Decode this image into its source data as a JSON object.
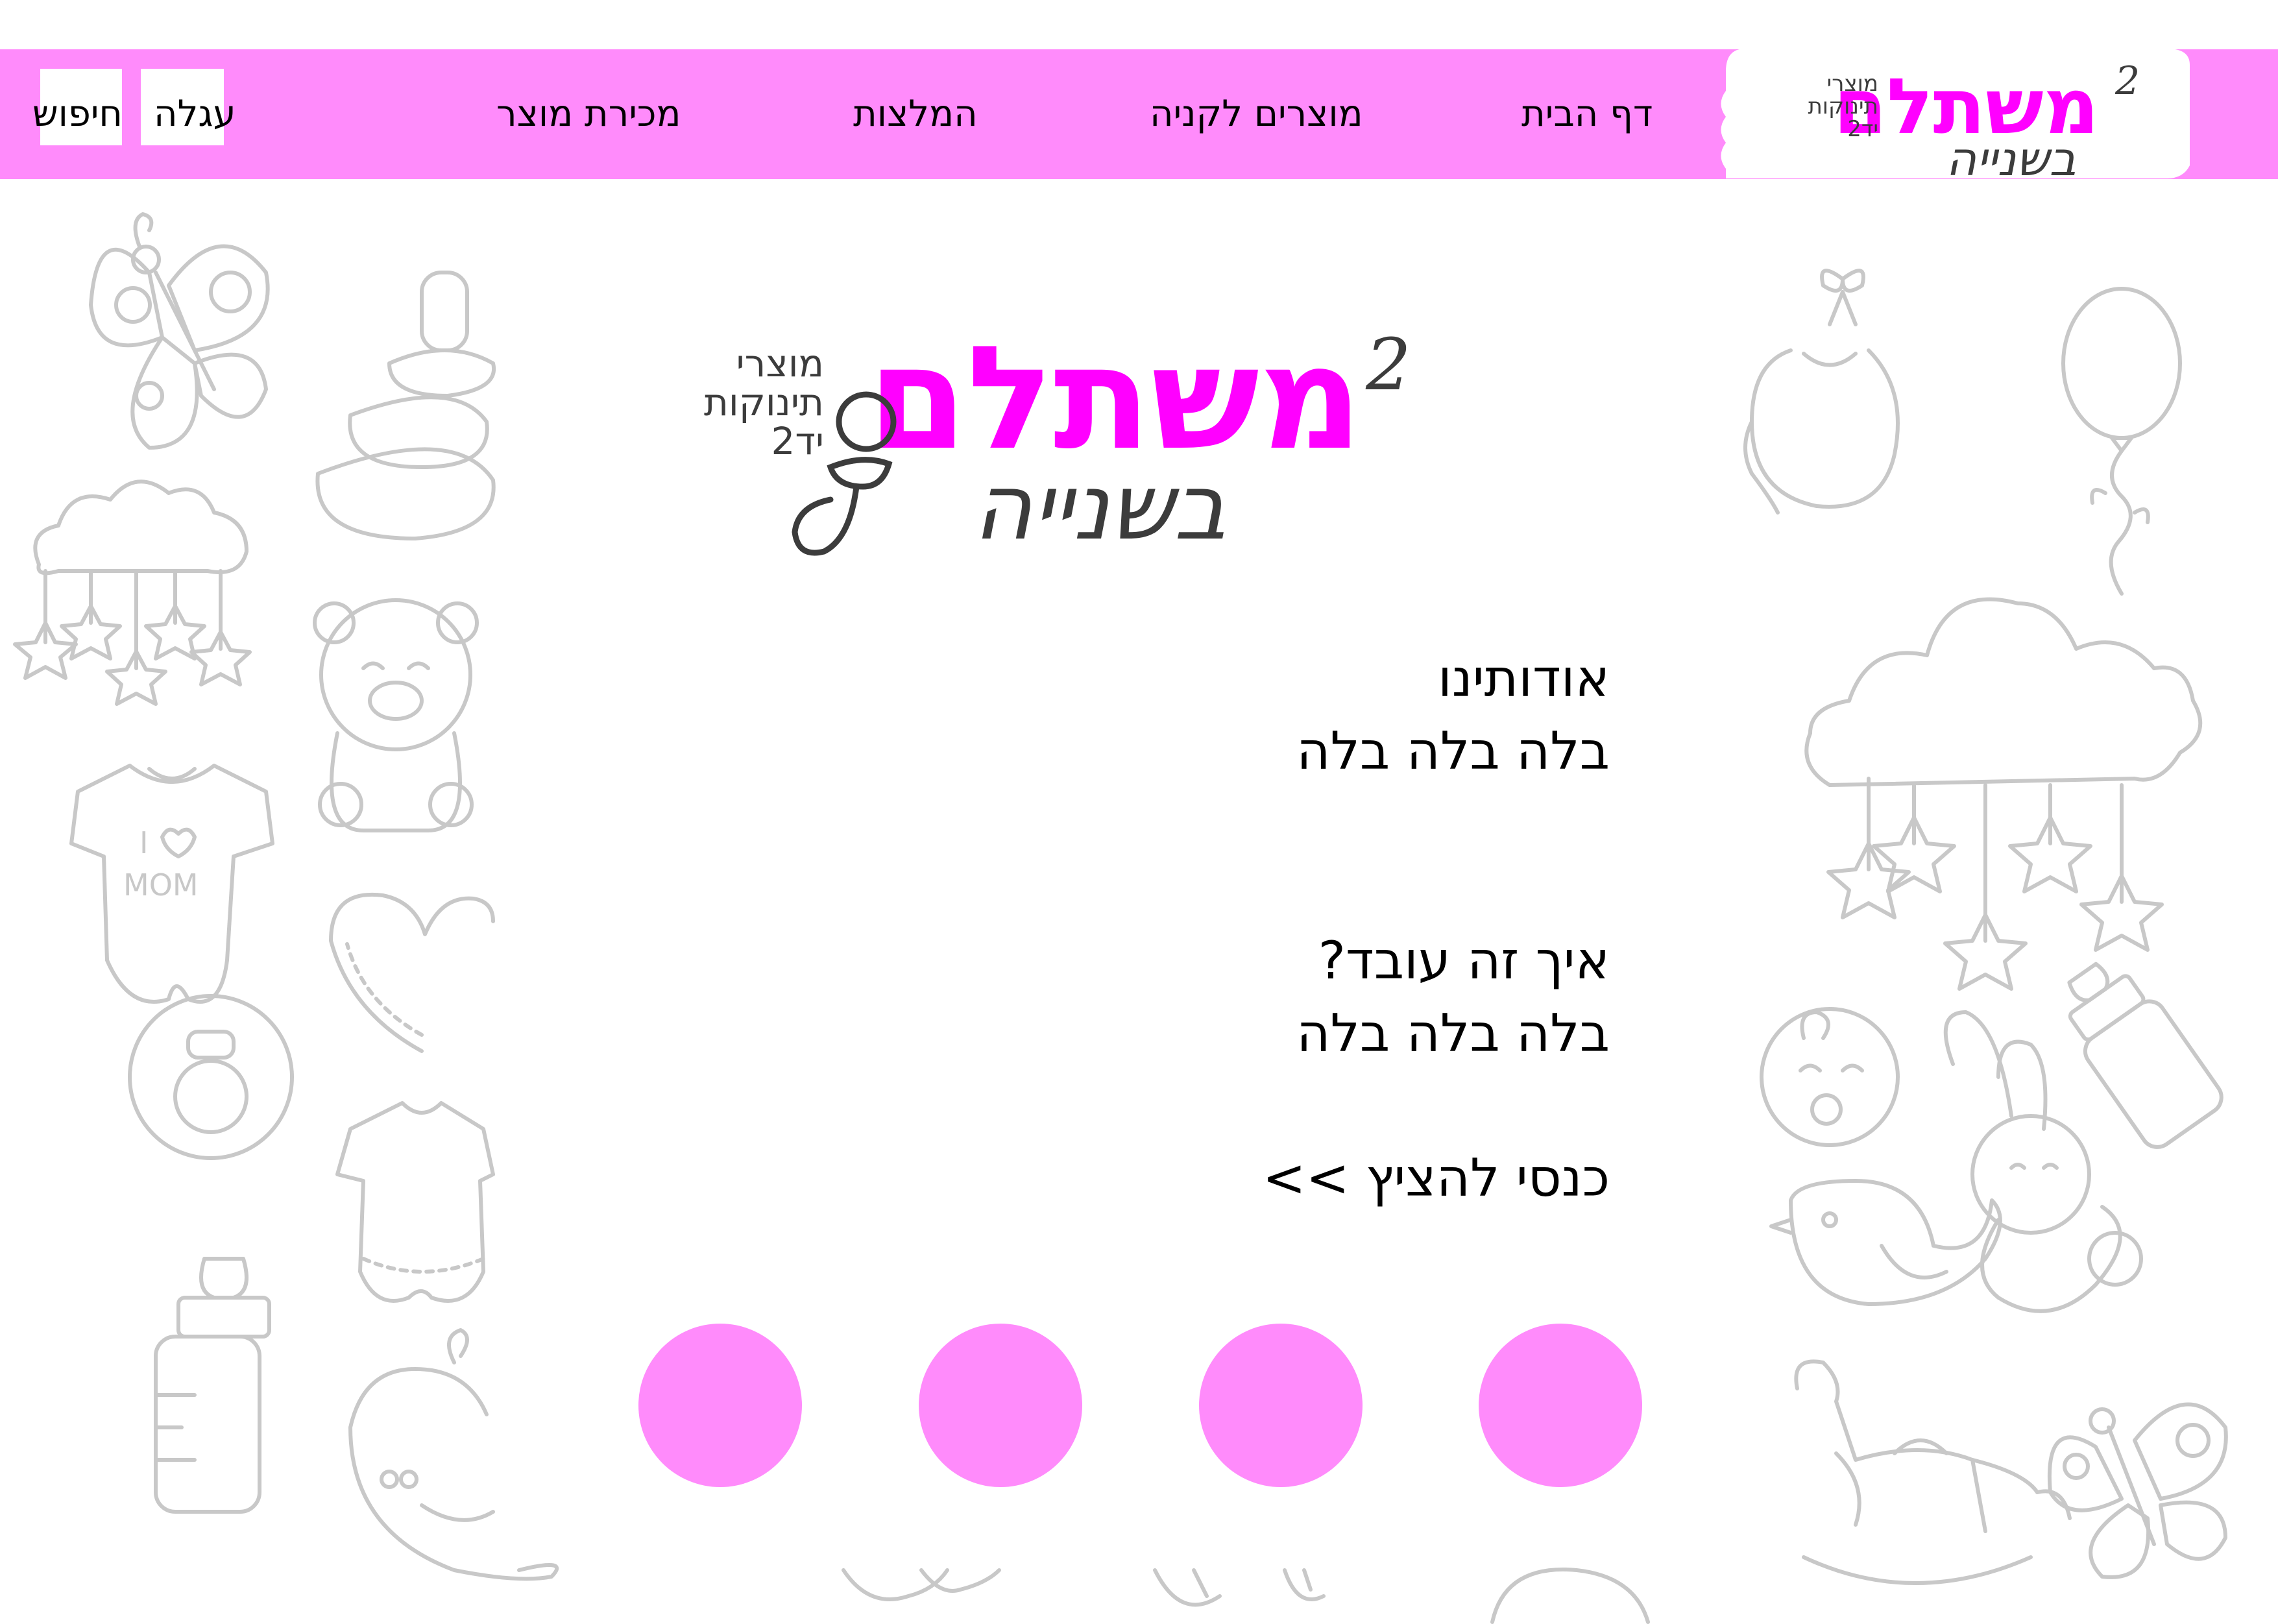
{
  "colors": {
    "brand_pink": "#ff8bfb",
    "logo_magenta": "#ff00ff",
    "doodle_gray": "#c8c8c8",
    "logo_gray": "#3c3c3c"
  },
  "logo": {
    "title": "משתלם",
    "superscript": "2",
    "subtitle": "בשנייה",
    "side_line_1": "מוצרי",
    "side_line_2": "תינוקות",
    "side_line_3": "יד2"
  },
  "nav": {
    "home": "דף הבית",
    "products": "מוצרים לקניה",
    "recommendations": "המלצות",
    "sell": "מכירת מוצר",
    "cart": "עגלה",
    "search": "חיפוש"
  },
  "content": {
    "about_title": "אודותינו",
    "about_body": "בלה בלה בלה",
    "how_title": "איך זה עובד?",
    "how_body": "בלה בלה בלה",
    "enter_link": "כנסי להציץ >>"
  },
  "doodles": {
    "onesie_text_1": "I",
    "onesie_text_2": "MOM"
  },
  "circles": [
    {
      "name": "circle-1"
    },
    {
      "name": "circle-2"
    },
    {
      "name": "circle-3"
    },
    {
      "name": "circle-4"
    }
  ]
}
